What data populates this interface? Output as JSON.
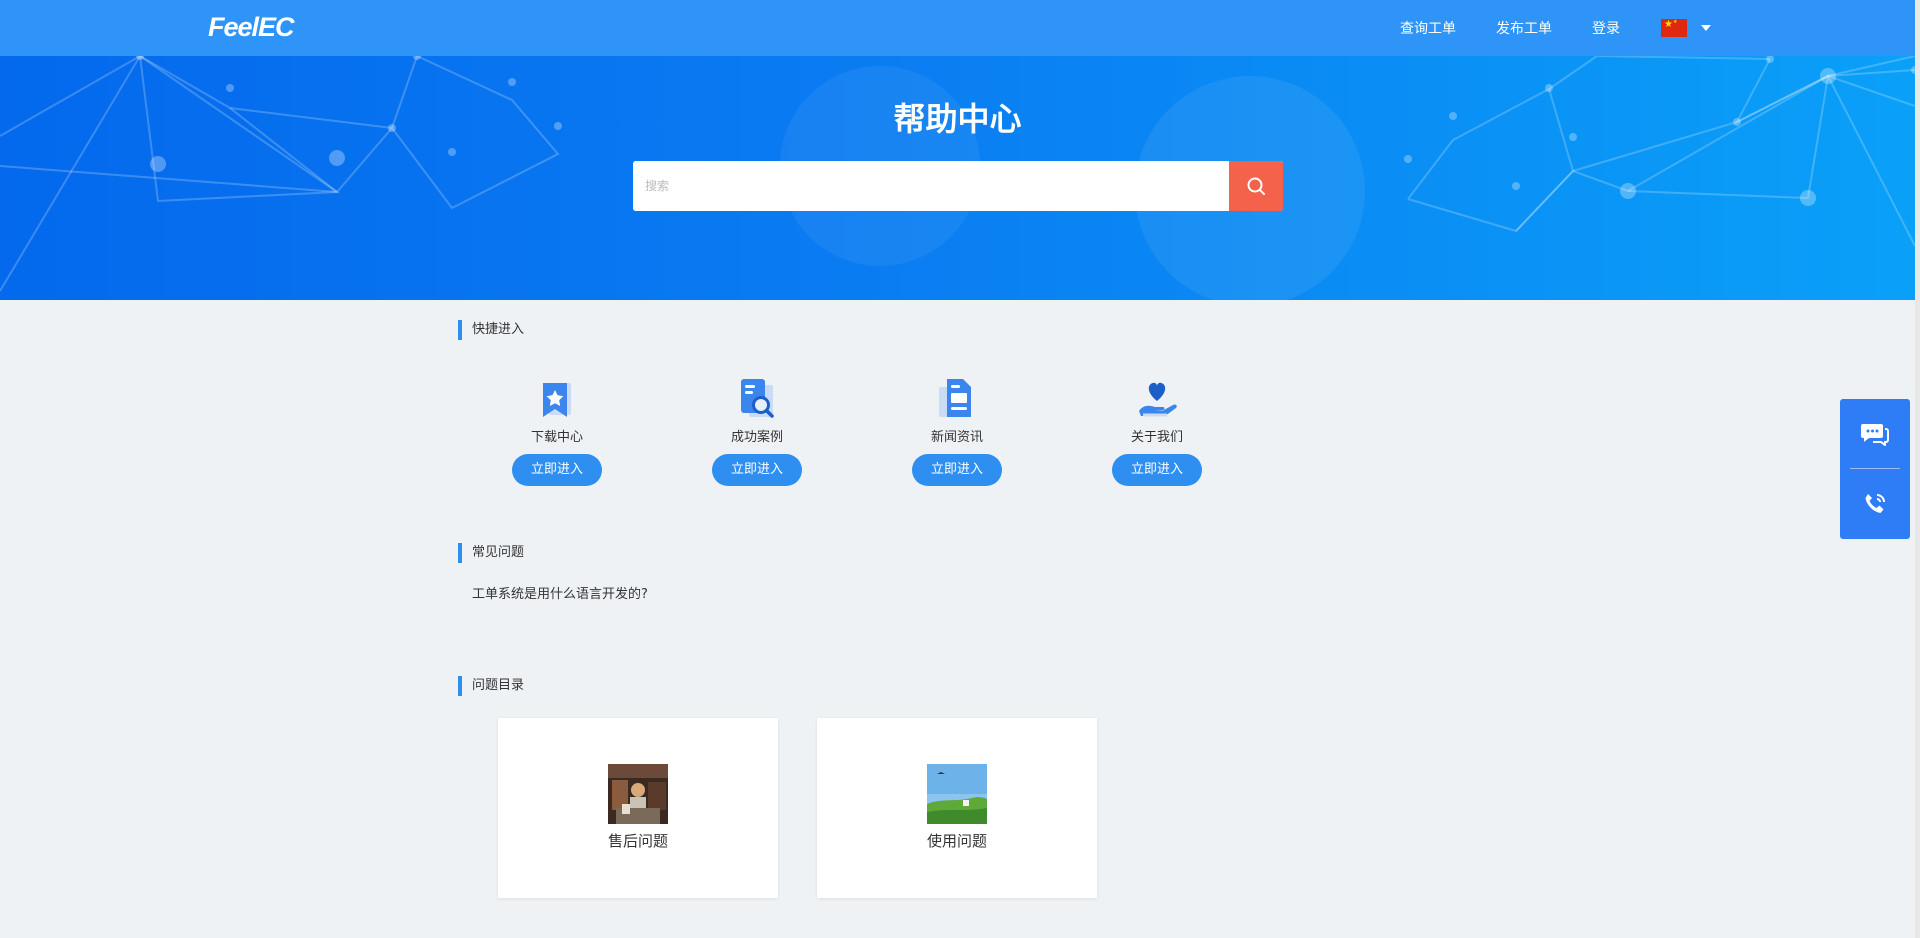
{
  "header": {
    "logo_text": "FeelEC",
    "nav": [
      "查询工单",
      "发布工单",
      "登录"
    ],
    "language_flag": "china-flag-icon"
  },
  "hero": {
    "title": "帮助中心",
    "search_placeholder": "搜索",
    "search_button_icon": "search-icon"
  },
  "quick_access": {
    "title": "快捷进入",
    "items": [
      {
        "label": "下载中心",
        "button": "立即进入",
        "icon": "bookmark-star-icon"
      },
      {
        "label": "成功案例",
        "button": "立即进入",
        "icon": "document-search-icon"
      },
      {
        "label": "新闻资讯",
        "button": "立即进入",
        "icon": "news-document-icon"
      },
      {
        "label": "关于我们",
        "button": "立即进入",
        "icon": "heart-hand-icon"
      }
    ]
  },
  "faq": {
    "title": "常见问题",
    "items": [
      "工单系统是用什么语言开发的?"
    ]
  },
  "catalog": {
    "title": "问题目录",
    "items": [
      {
        "label": "售后问题"
      },
      {
        "label": "使用问题"
      }
    ]
  },
  "float_panel": {
    "icons": [
      "chat-icon",
      "phone-icon"
    ]
  },
  "colors": {
    "topbar": "#2f94f8",
    "accent": "#2f8ff0",
    "search_button": "#f4624c",
    "float_panel": "#2e7cf6"
  }
}
